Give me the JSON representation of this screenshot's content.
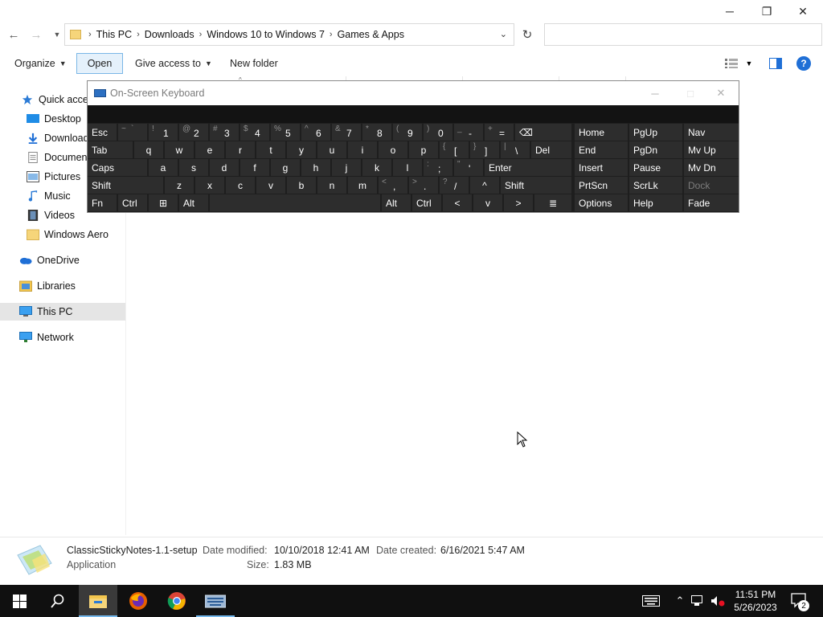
{
  "window": {
    "minimize": "─",
    "maximize": "❐",
    "close": "✕"
  },
  "address": {
    "crumbs": [
      "This PC",
      "Downloads",
      "Windows 10 to Windows 7",
      "Games & Apps"
    ],
    "separator": "›",
    "search_placeholder": ""
  },
  "commands": {
    "organize": "Organize",
    "open": "Open",
    "give_access": "Give access to",
    "new_folder": "New folder",
    "help": "?"
  },
  "nav": {
    "quick_access": "Quick acces",
    "desktop": "Desktop",
    "downloads": "Download",
    "documents": "Documen",
    "pictures": "Pictures",
    "music": "Music",
    "videos": "Videos",
    "windows_aero": "Windows Aero",
    "onedrive": "OneDrive",
    "libraries": "Libraries",
    "this_pc": "This PC",
    "network": "Network"
  },
  "osk": {
    "title": "On-Screen Keyboard",
    "row1": [
      {
        "s": "",
        "m": "Esc"
      },
      {
        "s": "~",
        "m": "`"
      },
      {
        "s": "!",
        "m": "1"
      },
      {
        "s": "@",
        "m": "2"
      },
      {
        "s": "#",
        "m": "3"
      },
      {
        "s": "$",
        "m": "4"
      },
      {
        "s": "%",
        "m": "5"
      },
      {
        "s": "^",
        "m": "6"
      },
      {
        "s": "&",
        "m": "7"
      },
      {
        "s": "*",
        "m": "8"
      },
      {
        "s": "(",
        "m": "9"
      },
      {
        "s": ")",
        "m": "0"
      },
      {
        "s": "_",
        "m": "-"
      },
      {
        "s": "+",
        "m": "="
      },
      {
        "s": "",
        "m": "⌫"
      }
    ],
    "row2": [
      "Tab",
      "q",
      "w",
      "e",
      "r",
      "t",
      "y",
      "u",
      "i",
      "o",
      "p",
      "[",
      "]",
      "\\",
      "Del"
    ],
    "row2_shift": [
      "",
      "",
      "",
      "",
      "",
      "",
      "",
      "",
      "",
      "",
      "",
      "{",
      "}",
      "|",
      ""
    ],
    "row3": [
      "Caps",
      "a",
      "s",
      "d",
      "f",
      "g",
      "h",
      "j",
      "k",
      "l",
      ";",
      "'",
      "Enter"
    ],
    "row3_shift": [
      "",
      "",
      "",
      "",
      "",
      "",
      "",
      "",
      "",
      "",
      ":",
      "\"",
      ""
    ],
    "row4": [
      "Shift",
      "z",
      "x",
      "c",
      "v",
      "b",
      "n",
      "m",
      ",",
      ".",
      "/",
      "^",
      "Shift"
    ],
    "row4_shift": [
      "",
      "",
      "",
      "",
      "",
      "",
      "",
      "",
      "<",
      ">",
      "?",
      "",
      ""
    ],
    "row5": [
      "Fn",
      "Ctrl",
      "⊞",
      "Alt",
      "",
      "Alt",
      "Ctrl",
      "<",
      "v",
      ">",
      "≣"
    ],
    "right": [
      [
        "Home",
        "PgUp",
        "Nav"
      ],
      [
        "End",
        "PgDn",
        "Mv Up"
      ],
      [
        "Insert",
        "Pause",
        "Mv Dn"
      ],
      [
        "PrtScn",
        "ScrLk",
        "Dock"
      ],
      [
        "Options",
        "Help",
        "Fade"
      ]
    ]
  },
  "details": {
    "name": "ClassicStickyNotes-1.1-setup",
    "type": "Application",
    "modified_label": "Date modified:",
    "modified": "10/10/2018 12:41 AM",
    "created_label": "Date created:",
    "created": "6/16/2021 5:47 AM",
    "size_label": "Size:",
    "size": "1.83 MB"
  },
  "taskbar": {
    "time": "11:51 PM",
    "date": "5/26/2023",
    "notifications": "2"
  },
  "colors": {
    "accent": "#0078d7",
    "osk_bg": "#1e1e1e",
    "osk_key": "#2d2d2d",
    "taskbar": "#101010"
  }
}
